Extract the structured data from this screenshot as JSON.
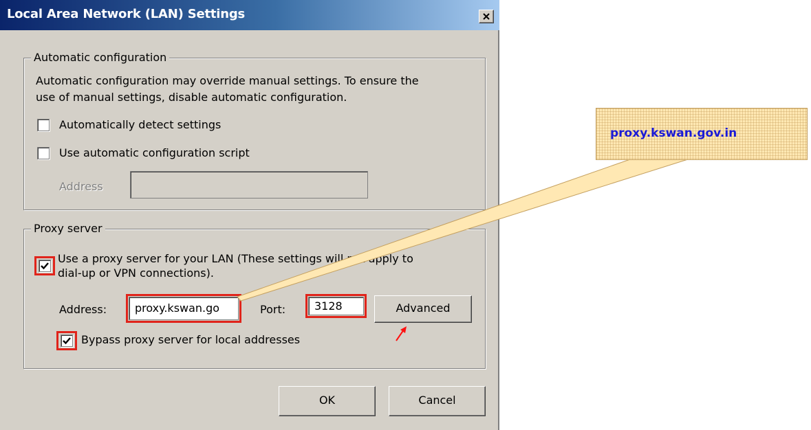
{
  "dialog": {
    "title": "Local Area Network (LAN) Settings"
  },
  "auto_config": {
    "legend": "Automatic configuration",
    "desc_line1": "Automatic configuration may override manual settings.  To ensure the",
    "desc_line2": "use of manual settings, disable automatic configuration.",
    "detect_label": "Automatically detect settings",
    "detect_checked": false,
    "script_label": "Use automatic configuration script",
    "script_checked": false,
    "address_label": "Address",
    "address_value": ""
  },
  "proxy": {
    "legend": "Proxy server",
    "use_proxy_line1": "Use a proxy server for your LAN (These settings will not apply to",
    "use_proxy_line2": "dial-up or VPN connections).",
    "use_proxy_checked": true,
    "address_label": "Address:",
    "address_value": "proxy.kswan.go",
    "port_label": "Port:",
    "port_value": "3128",
    "advanced_label": "Advanced",
    "bypass_label": "Bypass proxy server for local addresses",
    "bypass_checked": true
  },
  "buttons": {
    "ok": "OK",
    "cancel": "Cancel"
  },
  "callout": {
    "text": "proxy.kswan.gov.in"
  },
  "colors": {
    "title_gradient_start": "#0a246a",
    "highlight": "#e0241b",
    "callout_fill": "#ffe8b3",
    "callout_text": "#1a1ad6"
  }
}
